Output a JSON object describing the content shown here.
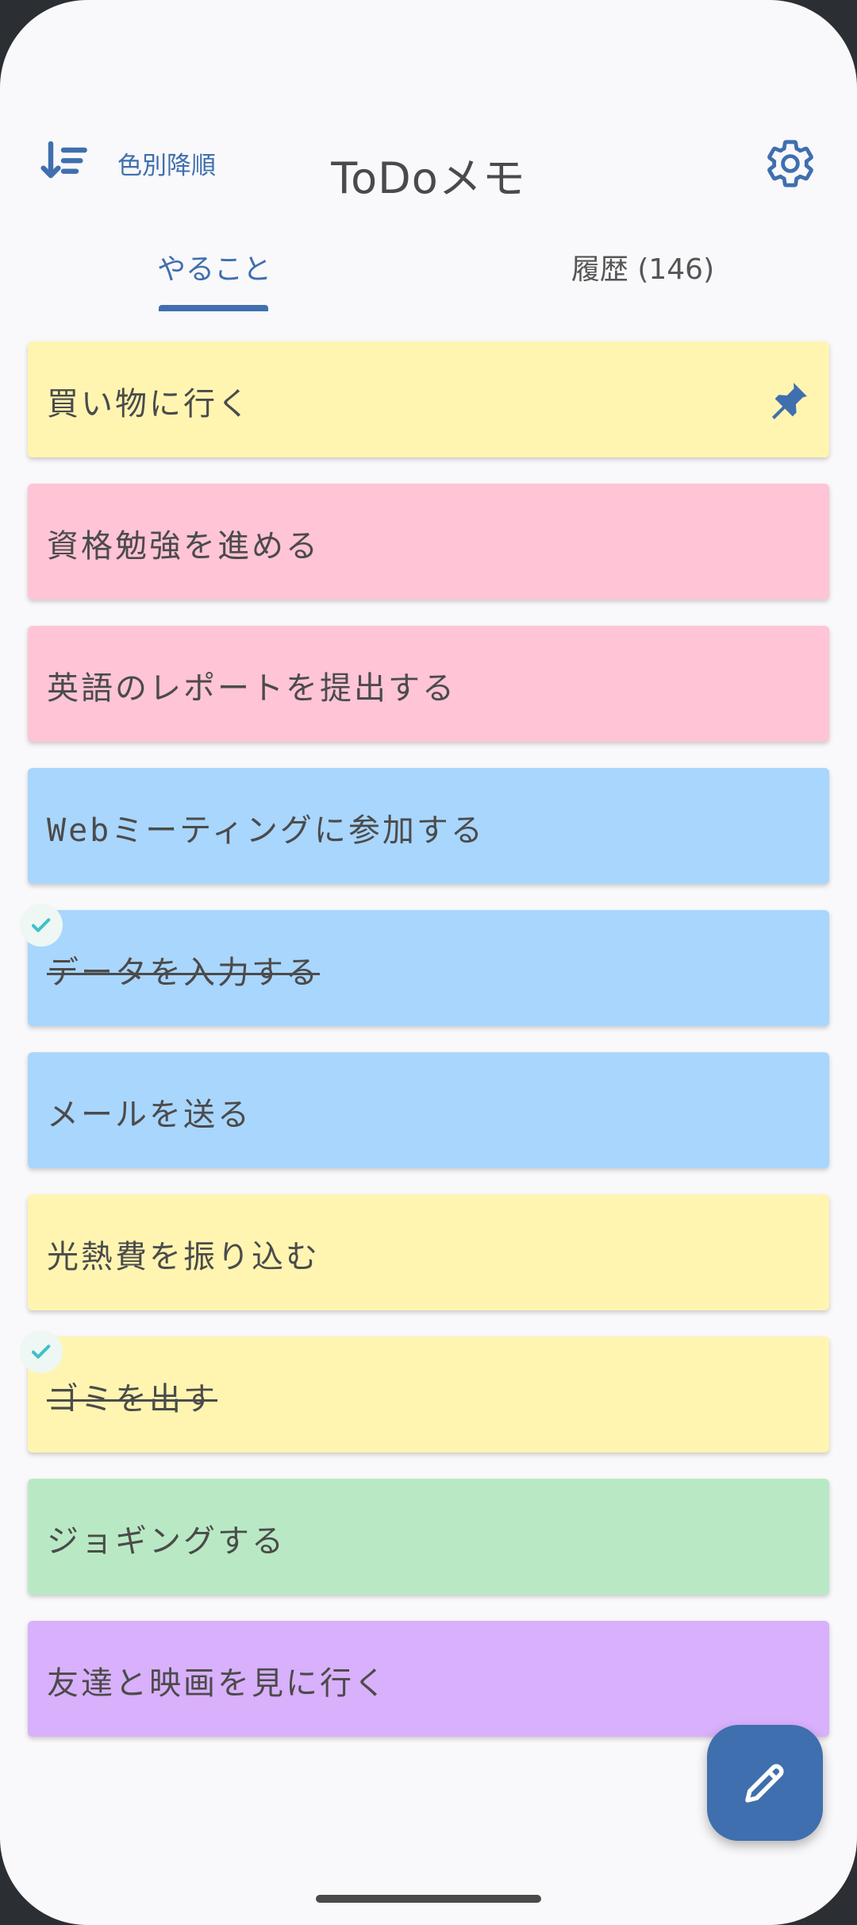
{
  "header": {
    "sort_label": "色別降順",
    "title": "ToDoメモ"
  },
  "tabs": [
    {
      "label": "やること",
      "active": true
    },
    {
      "label": "履歴 (146)",
      "active": false
    }
  ],
  "todos": [
    {
      "text": "買い物に行く",
      "color": "#fff5b1",
      "done": false,
      "pinned": true
    },
    {
      "text": "資格勉強を進める",
      "color": "#ffc4d6",
      "done": false,
      "pinned": false
    },
    {
      "text": "英語のレポートを提出する",
      "color": "#ffc4d6",
      "done": false,
      "pinned": false
    },
    {
      "text": "Webミーティングに参加する",
      "color": "#a9d6fd",
      "done": false,
      "pinned": false
    },
    {
      "text": "データを入力する",
      "color": "#a9d6fd",
      "done": true,
      "pinned": false
    },
    {
      "text": "メールを送る",
      "color": "#a9d6fd",
      "done": false,
      "pinned": false
    },
    {
      "text": "光熱費を振り込む",
      "color": "#fff5b1",
      "done": false,
      "pinned": false
    },
    {
      "text": "ゴミを出す",
      "color": "#fff5b1",
      "done": true,
      "pinned": false
    },
    {
      "text": "ジョギングする",
      "color": "#b9e9c4",
      "done": false,
      "pinned": false
    },
    {
      "text": "友達と映画を見に行く",
      "color": "#d9b0fb",
      "done": false,
      "pinned": false
    }
  ],
  "colors": {
    "accent": "#3f6fae",
    "check": "#3ec1c9"
  },
  "icons": {
    "sort": "sort-descending-icon",
    "settings": "gear-icon",
    "pin": "pin-icon",
    "check": "check-icon",
    "fab": "pencil-icon"
  }
}
